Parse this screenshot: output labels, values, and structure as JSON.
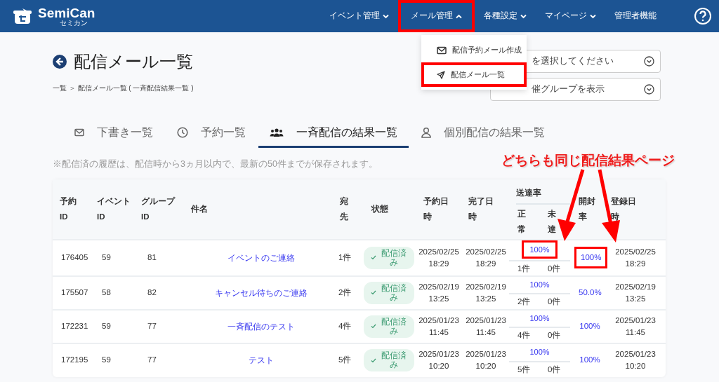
{
  "header": {
    "logo": "SemiCan",
    "logo_sub": "セミカン",
    "nav": [
      {
        "label": "イベント管理",
        "kind": "dropdown",
        "expanded": false,
        "highlighted": false
      },
      {
        "label": "メール管理",
        "kind": "dropdown",
        "expanded": true,
        "highlighted": true
      },
      {
        "label": "各種設定",
        "kind": "dropdown",
        "expanded": false,
        "highlighted": false
      },
      {
        "label": "マイページ",
        "kind": "dropdown",
        "expanded": false,
        "highlighted": false
      },
      {
        "label": "管理者機能",
        "kind": "link",
        "highlighted": false
      }
    ]
  },
  "dropdown": [
    {
      "label": "配信予約メール作成",
      "highlighted": false
    },
    {
      "label": "配信メール一覧",
      "highlighted": true
    }
  ],
  "selects": [
    "を選択してください",
    "催グループを表示"
  ],
  "title": "配信メール一覧",
  "breadcrumb": "一覧 ＞ 配信メール一覧 ( 一斉配信結果一覧 )",
  "tabs": [
    {
      "label": "下書き一覧",
      "selected": false
    },
    {
      "label": "予約一覧",
      "selected": false
    },
    {
      "label": "一斉配信の結果一覧",
      "selected": true
    },
    {
      "label": "個別配信の結果一覧",
      "selected": false
    }
  ],
  "note": "※配信済の履歴は、配信時から3ヵ月以内で、最新の50件までが保存されます。",
  "table": {
    "columns": [
      "予約ID",
      "イベントID",
      "グループID",
      "件名",
      "宛先",
      "状態",
      "予約日時",
      "完了日時",
      "送達率",
      "正常",
      "未達",
      "開封率",
      "登録日時"
    ],
    "rows": [
      {
        "id": "176405",
        "event_id": "59",
        "group_id": "81",
        "subject": "イベントのご連絡",
        "recipients": "1件",
        "status": "配信済み",
        "reserved": "2025/02/25 18:29",
        "completed": "2025/02/25 18:29",
        "delivery_rate": "100%",
        "delivery_highlighted": true,
        "normal": "1件",
        "failed": "0件",
        "open_rate": "100%",
        "open_highlighted": true,
        "registered": "2025/02/25 18:29"
      },
      {
        "id": "175507",
        "event_id": "58",
        "group_id": "82",
        "subject": "キャンセル待ちのご連絡",
        "recipients": "2件",
        "status": "配信済み",
        "reserved": "2025/02/19 13:25",
        "completed": "2025/02/19 13:25",
        "delivery_rate": "100%",
        "delivery_highlighted": false,
        "normal": "2件",
        "failed": "0件",
        "open_rate": "50.0%",
        "open_highlighted": false,
        "registered": "2025/02/19 13:25"
      },
      {
        "id": "172231",
        "event_id": "59",
        "group_id": "77",
        "subject": "一斉配信のテスト",
        "recipients": "4件",
        "status": "配信済み",
        "reserved": "2025/01/23 11:45",
        "completed": "2025/01/23 11:45",
        "delivery_rate": "100%",
        "delivery_highlighted": false,
        "normal": "4件",
        "failed": "0件",
        "open_rate": "100%",
        "open_highlighted": false,
        "registered": "2025/01/23 11:45"
      },
      {
        "id": "172195",
        "event_id": "59",
        "group_id": "77",
        "subject": "テスト",
        "recipients": "5件",
        "status": "配信済み",
        "reserved": "2025/01/23 10:20",
        "completed": "2025/01/23 10:20",
        "delivery_rate": "100%",
        "delivery_highlighted": false,
        "normal": "5件",
        "failed": "0件",
        "open_rate": "100%",
        "open_highlighted": false,
        "registered": "2025/01/23 10:20"
      }
    ]
  },
  "annotation": {
    "label": "どちらも同じ配信結果ページ"
  }
}
